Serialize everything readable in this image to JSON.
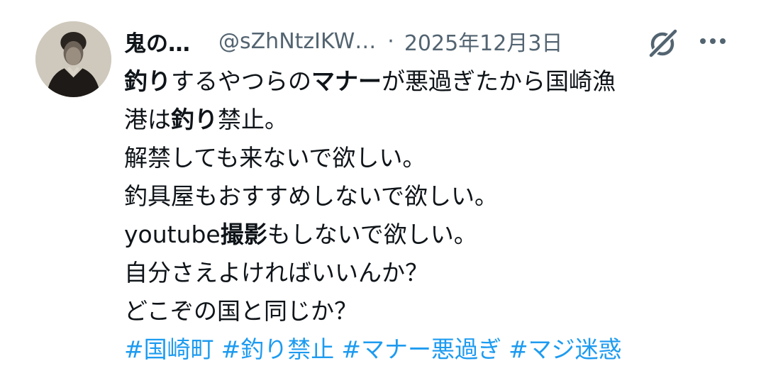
{
  "author": {
    "display_name": "鬼の…",
    "handle": "@sZhNtzIKW…",
    "separator": "·",
    "date": "2025年12月3日"
  },
  "icons": {
    "grok": "grok-icon",
    "more": "more-options-icon",
    "avatar": "avatar-portrait"
  },
  "post": {
    "lines": [
      [
        {
          "text": "釣り",
          "bold": true
        },
        {
          "text": "するやつらの",
          "bold": false
        },
        {
          "text": "マナー",
          "bold": true
        },
        {
          "text": "が悪過ぎたから国崎漁",
          "bold": false
        }
      ],
      [
        {
          "text": "港は",
          "bold": false
        },
        {
          "text": "釣り",
          "bold": true
        },
        {
          "text": "禁止。",
          "bold": false
        }
      ],
      [
        {
          "text": "解禁しても来ないで欲しい。",
          "bold": false
        }
      ],
      [
        {
          "text": "釣具屋もおすすめしないで欲しい。",
          "bold": false
        }
      ],
      [
        {
          "text": "youtube",
          "bold": false
        },
        {
          "text": "撮影",
          "bold": true
        },
        {
          "text": "もしないで欲しい。",
          "bold": false
        }
      ],
      [
        {
          "text": "自分さえよければいいんか？",
          "bold": false
        }
      ],
      [
        {
          "text": "どこぞの国と同じか？",
          "bold": false
        }
      ]
    ],
    "hashtags": [
      "#国崎町",
      "#釣り禁止",
      "#マナー悪過ぎ",
      "#マジ迷惑"
    ]
  },
  "colors": {
    "text": "#0f1419",
    "secondary": "#536471",
    "link": "#1d9bf0",
    "background": "#ffffff"
  }
}
